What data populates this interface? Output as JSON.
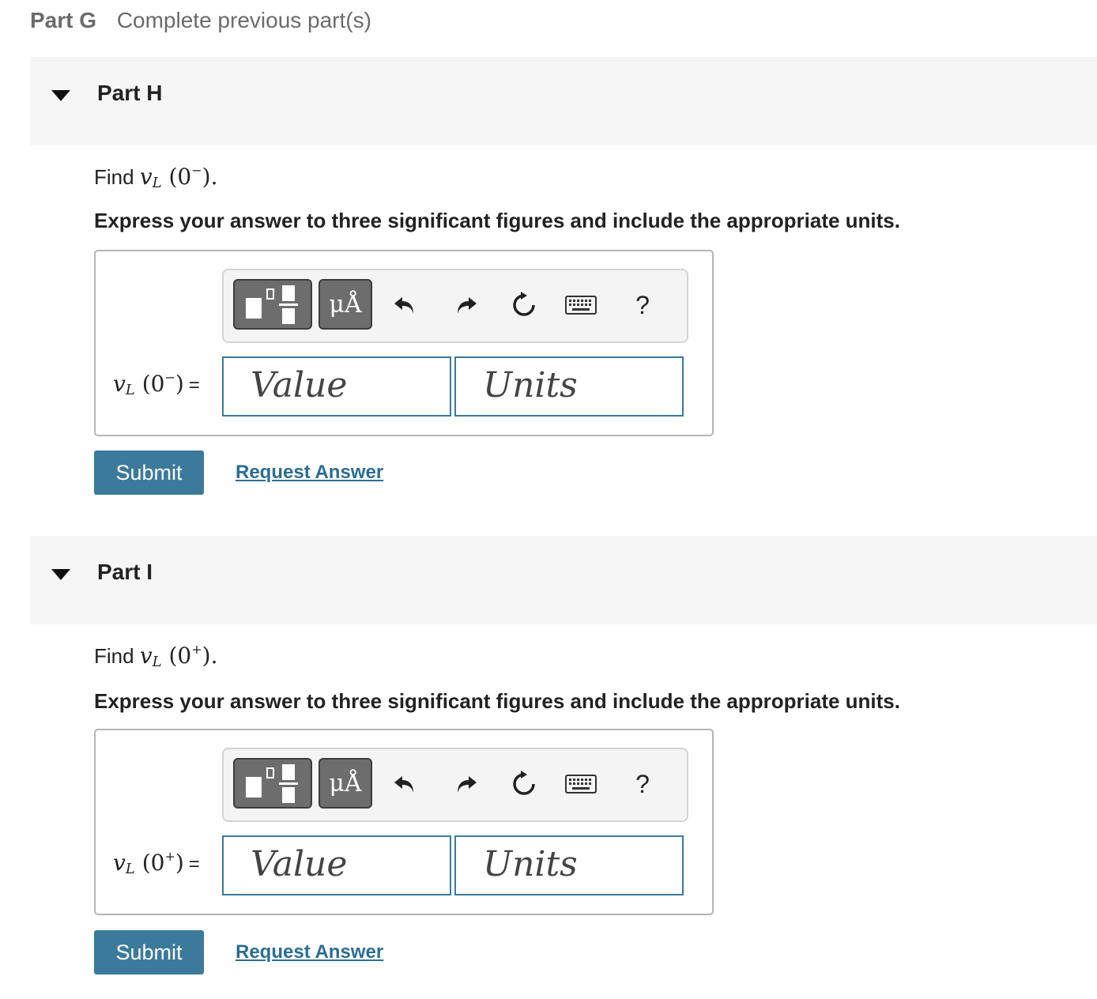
{
  "part_g": {
    "label": "Part G",
    "status": "Complete previous part(s)"
  },
  "parts": [
    {
      "title": "Part H",
      "find_prefix": "Find",
      "var": "v",
      "sub": "L",
      "arg_open": "(0",
      "arg_sup": "−",
      "arg_close": ").",
      "instruction": "Express your answer to three significant figures and include the appropriate units.",
      "eq_open": "(0",
      "eq_sup": "−",
      "eq_close": ")",
      "eq_sign": "=",
      "value_placeholder": "Value",
      "units_placeholder": "Units",
      "units_button": "μÅ",
      "help": "?",
      "submit": "Submit",
      "request": "Request Answer"
    },
    {
      "title": "Part I",
      "find_prefix": "Find",
      "var": "v",
      "sub": "L",
      "arg_open": "(0",
      "arg_sup": "+",
      "arg_close": ").",
      "instruction": "Express your answer to three significant figures and include the appropriate units.",
      "eq_open": "(0",
      "eq_sup": "+",
      "eq_close": ")",
      "eq_sign": "=",
      "value_placeholder": "Value",
      "units_placeholder": "Units",
      "units_button": "μÅ",
      "help": "?",
      "submit": "Submit",
      "request": "Request Answer"
    }
  ],
  "icons": {
    "collapse": "caret-down-icon",
    "templates": "templates-icon",
    "undo": "undo-icon",
    "redo": "redo-icon",
    "reset": "reset-icon",
    "keyboard": "keyboard-icon",
    "help": "help-icon"
  },
  "colors": {
    "accent": "#3c7a9b",
    "link": "#2b6d94",
    "header_bg": "#f6f6f6",
    "input_border": "#3a7a9a"
  }
}
